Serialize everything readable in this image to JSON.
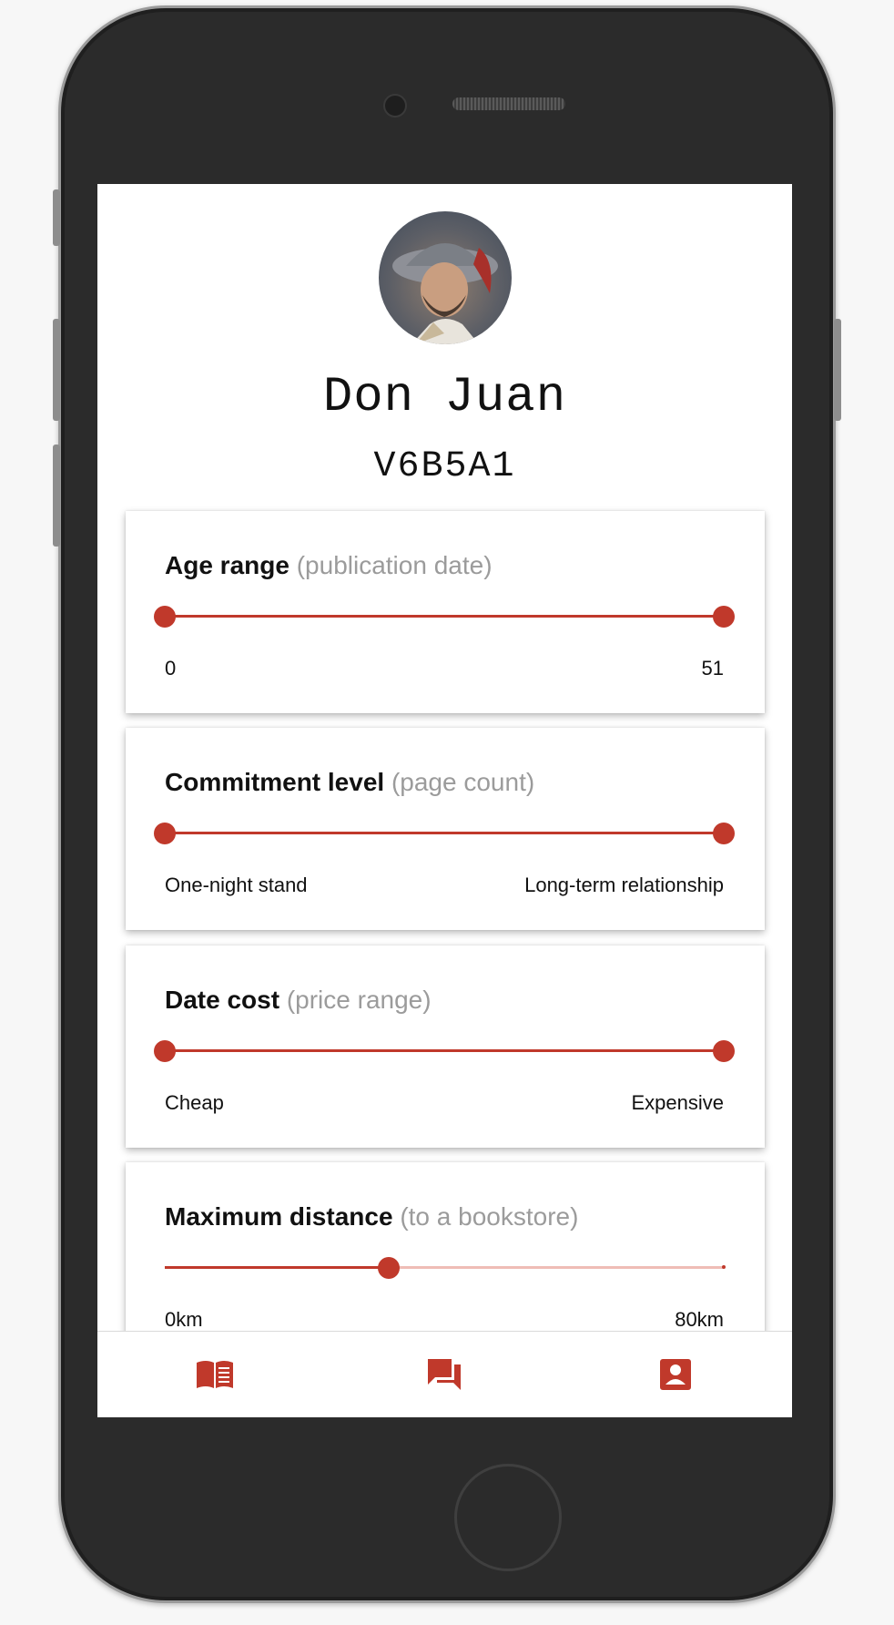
{
  "profile": {
    "name": "Don Juan",
    "code": "V6B5A1"
  },
  "filters": [
    {
      "title": "Age range",
      "subtitle": "(publication date)",
      "min_label": "0",
      "max_label": "51",
      "type": "range",
      "low": 0,
      "high": 1
    },
    {
      "title": "Commitment level",
      "subtitle": "(page count)",
      "min_label": "One-night stand",
      "max_label": "Long-term relationship",
      "type": "range",
      "low": 0,
      "high": 1
    },
    {
      "title": "Date cost",
      "subtitle": "(price range)",
      "min_label": "Cheap",
      "max_label": "Expensive",
      "type": "range",
      "low": 0,
      "high": 1
    },
    {
      "title": "Maximum distance",
      "subtitle": "(to a bookstore)",
      "min_label": "0km",
      "max_label": "80km",
      "type": "single",
      "value": 0.4
    }
  ],
  "nav": [
    {
      "icon": "book-icon"
    },
    {
      "icon": "chat-icon"
    },
    {
      "icon": "profile-icon"
    }
  ],
  "colors": {
    "accent": "#c0392b",
    "accent_light": "#efbdb6"
  }
}
